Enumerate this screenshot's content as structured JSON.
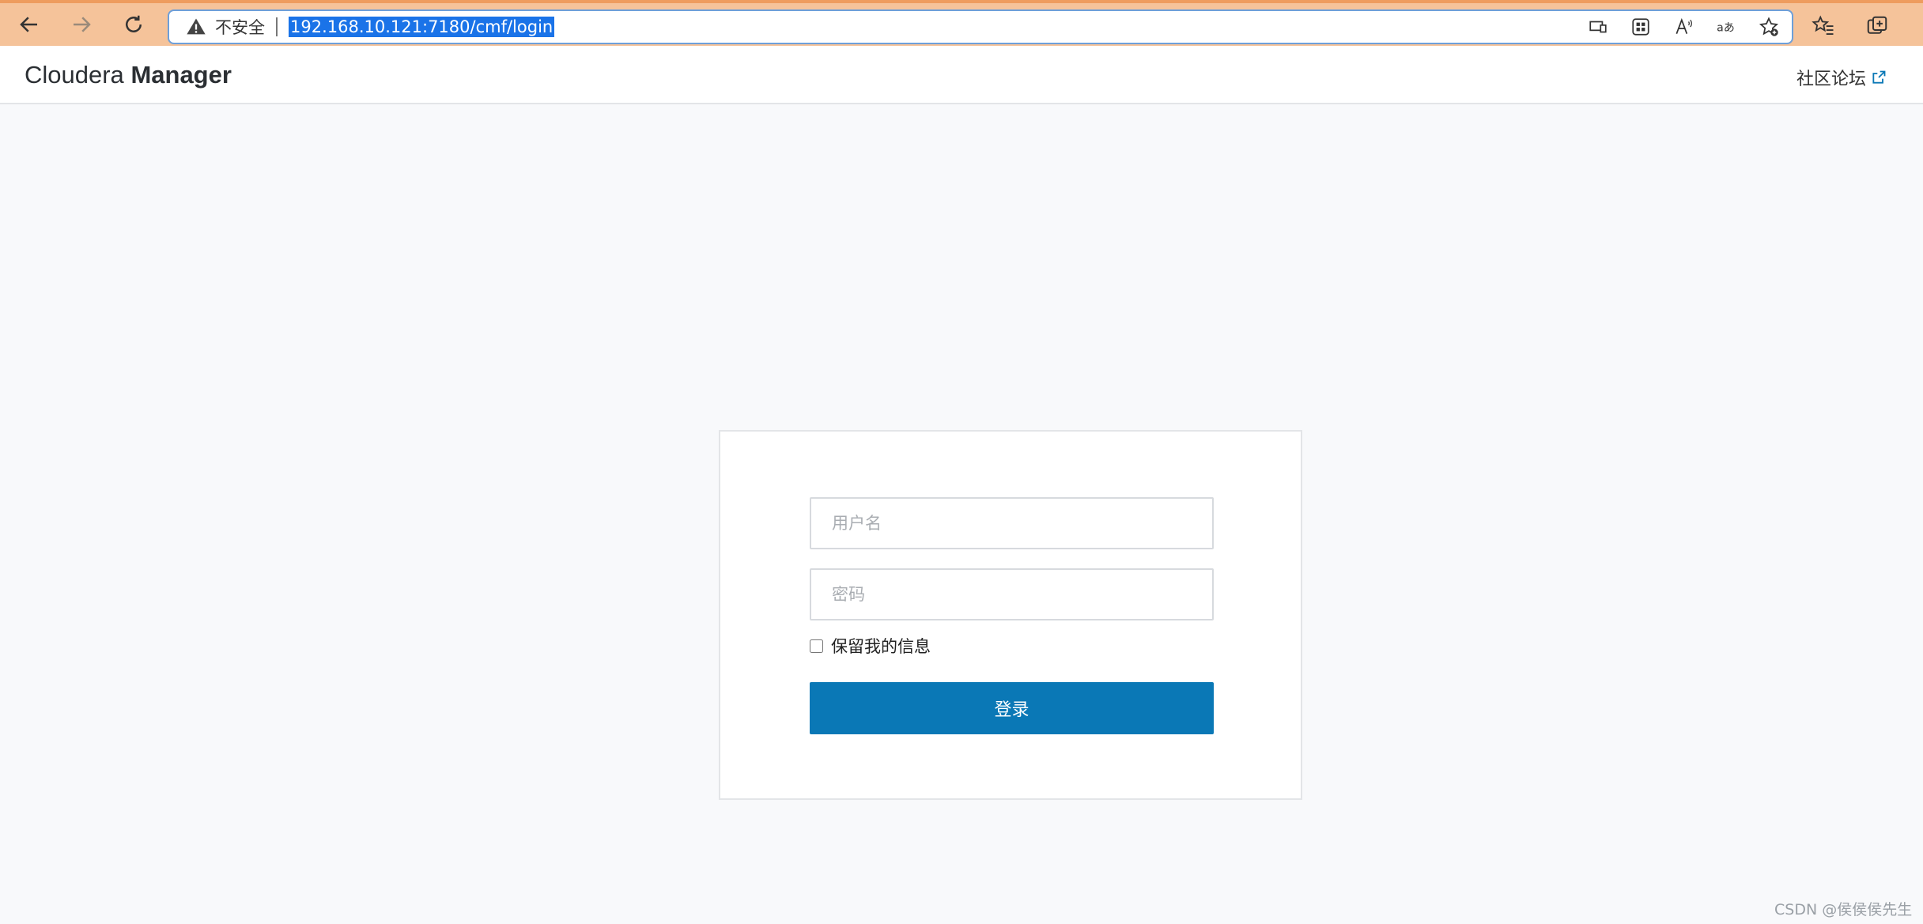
{
  "browser": {
    "address": {
      "security_label": "不安全",
      "url": "192.168.10.121:7180/cmf/login"
    },
    "icons": {
      "back": "back-arrow-icon",
      "forward": "forward-arrow-icon",
      "refresh": "refresh-icon",
      "warning": "warning-triangle-icon",
      "cast": "cast-device-icon",
      "apps": "apps-grid-icon",
      "read_aloud": "read-aloud-icon",
      "translate": "translate-icon",
      "add_favorite": "add-favorite-icon",
      "favorites": "favorites-list-icon",
      "collections": "collections-icon"
    },
    "accent_color": "#f5c39a"
  },
  "header": {
    "brand_light": "Cloudera",
    "brand_bold": "Manager",
    "community_link": "社区论坛"
  },
  "login": {
    "username_placeholder": "用户名",
    "password_placeholder": "密码",
    "remember_label": "保留我的信息",
    "remember_checked": false,
    "submit_label": "登录",
    "button_color": "#0a78b6"
  },
  "watermark": "CSDN @侯侯侯先生"
}
